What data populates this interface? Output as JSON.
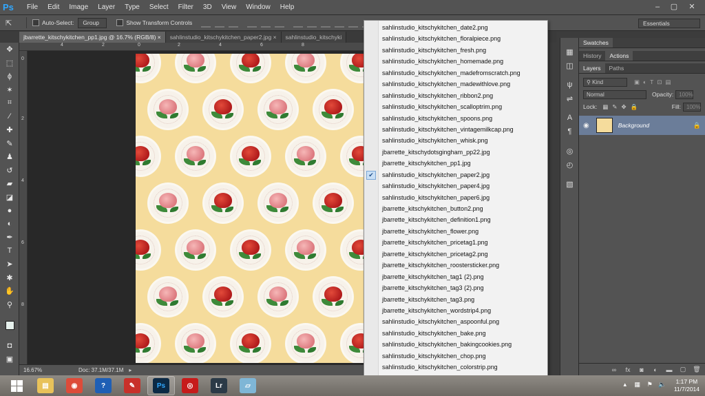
{
  "app": {
    "logo": "Ps",
    "menus": [
      "File",
      "Edit",
      "Image",
      "Layer",
      "Type",
      "Select",
      "Filter",
      "3D",
      "View",
      "Window",
      "Help"
    ],
    "window_controls": [
      "–",
      "▢",
      "✕"
    ]
  },
  "options_bar": {
    "auto_select_label": "Auto-Select:",
    "auto_select_value": "Group",
    "show_transform_label": "Show Transform Controls",
    "workspace": "Essentials"
  },
  "tabs": [
    {
      "label": "jbarrette_kitschykitchen_pp1.jpg @ 16.7% (RGB/8)",
      "close": "×"
    },
    {
      "label": "sahlinstudio_kitschykitchen_paper2.jpg",
      "close": "×"
    },
    {
      "label": "sahlinstudio_kitschyki",
      "close": ""
    }
  ],
  "rulers": {
    "top": [
      "4",
      "2",
      "0",
      "2",
      "4",
      "6",
      "8"
    ],
    "left": [
      "0",
      "2",
      "4",
      "6",
      "8"
    ]
  },
  "status": {
    "zoom": "16.67%",
    "doc": "Doc: 37.1M/37.1M"
  },
  "panels": {
    "top_tab": "Swatches",
    "history_tabs": [
      "History",
      "Actions"
    ],
    "layer_tabs": [
      "Layers",
      "Paths"
    ],
    "kind": "Kind",
    "blend_mode": "Normal",
    "opacity_label": "Opacity:",
    "opacity_value": "100%",
    "lock_label": "Lock:",
    "fill_label": "Fill:",
    "fill_value": "100%",
    "layer_name": "Background"
  },
  "popup": {
    "checked_index": 13,
    "items": [
      "sahlinstudio_kitschykitchen_date2.png",
      "sahlinstudio_kitschykitchen_floralpiece.png",
      "sahlinstudio_kitschykitchen_fresh.png",
      "sahlinstudio_kitschykitchen_homemade.png",
      "sahlinstudio_kitschykitchen_madefromscratch.png",
      "sahlinstudio_kitschykitchen_madewithlove.png",
      "sahlinstudio_kitschykitchen_ribbon2.png",
      "sahlinstudio_kitschykitchen_scalloptrim.png",
      "sahlinstudio_kitschykitchen_spoons.png",
      "sahlinstudio_kitschykitchen_vintagemilkcap.png",
      "sahlinstudio_kitschykitchen_whisk.png",
      "jbarrette_kitschydotsgingham_pp22.jpg",
      "jbarrette_kitschykitchen_pp1.jpg",
      "sahlinstudio_kitschykitchen_paper2.jpg",
      "sahlinstudio_kitschykitchen_paper4.jpg",
      "sahlinstudio_kitschykitchen_paper6.jpg",
      "jbarrette_kitschykitchen_button2.png",
      "jbarrette_kitschykitchen_definition1.png",
      "jbarrette_kitschykitchen_flower.png",
      "jbarrette_kitschykitchen_pricetag1.png",
      "jbarrette_kitschykitchen_pricetag2.png",
      "jbarrette_kitschykitchen_roostersticker.png",
      "jbarrette_kitschykitchen_tag1 (2).png",
      "jbarrette_kitschykitchen_tag3 (2).png",
      "jbarrette_kitschykitchen_tag3.png",
      "jbarrette_kitschykitchen_wordstrip4.png",
      "sahlinstudio_kitschykitchen_aspoonful.png",
      "sahlinstudio_kitschykitchen_bake.png",
      "sahlinstudio_kitschykitchen_bakingcookies.png",
      "sahlinstudio_kitschykitchen_chop.png",
      "sahlinstudio_kitschykitchen_colorstrip.png"
    ]
  },
  "taskbar": {
    "apps": [
      {
        "name": "explorer",
        "glyph": "▤",
        "color": "#e8c25a"
      },
      {
        "name": "chrome",
        "glyph": "◉",
        "color": "#dd4b39"
      },
      {
        "name": "help",
        "glyph": "?",
        "color": "#1f5fb5"
      },
      {
        "name": "acrobat",
        "glyph": "✎",
        "color": "#c8302a"
      },
      {
        "name": "photoshop",
        "glyph": "Ps",
        "color": "#0c2a45"
      },
      {
        "name": "creative-cloud",
        "glyph": "◎",
        "color": "#c61b1b"
      },
      {
        "name": "lightroom",
        "glyph": "Lr",
        "color": "#2b3a47"
      },
      {
        "name": "app",
        "glyph": "▱",
        "color": "#7fb6d6"
      }
    ],
    "time": "1:17 PM",
    "date": "11/7/2014"
  }
}
